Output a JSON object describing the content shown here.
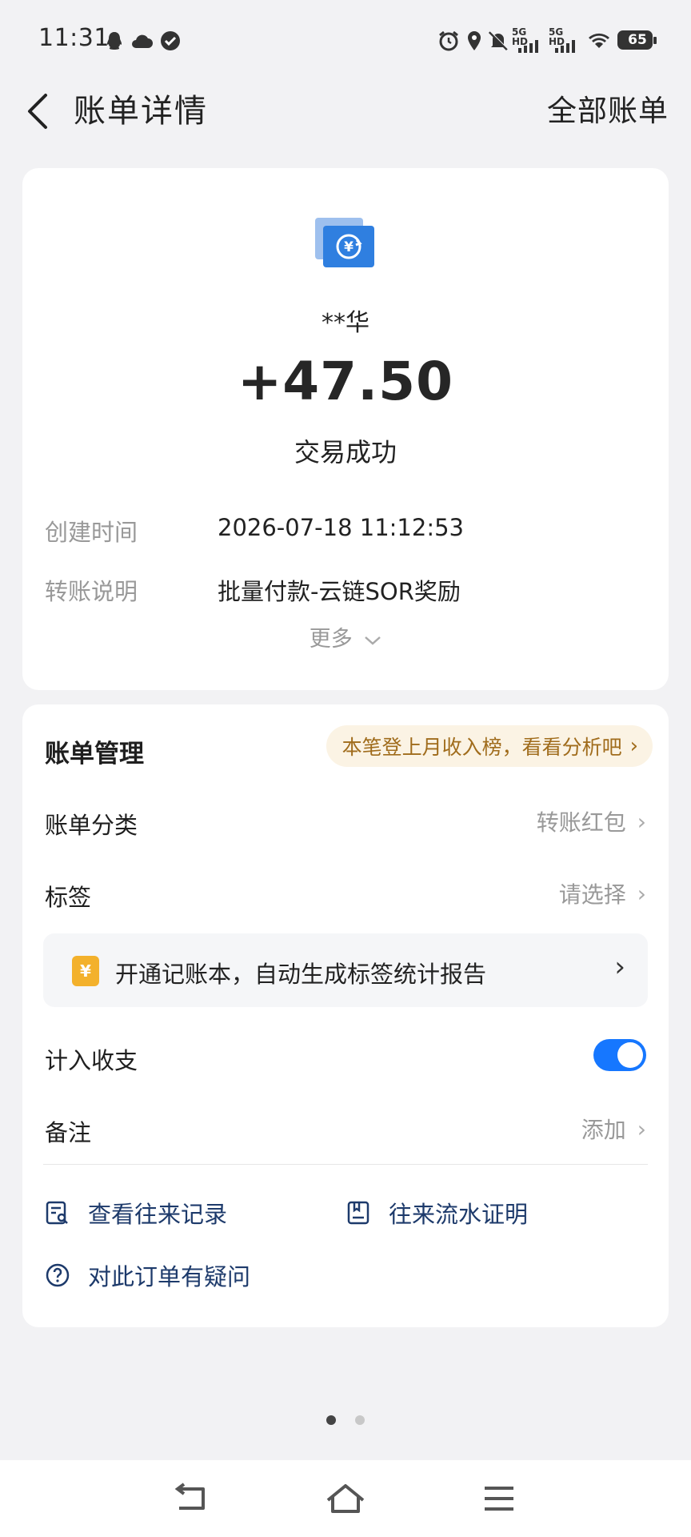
{
  "status_bar": {
    "time": "11:31",
    "battery": "65",
    "signal_label": "5G HD",
    "icons": [
      "qq-icon",
      "cloud-icon",
      "check-circle-icon",
      "alarm-icon",
      "location-icon",
      "mute-bell-icon",
      "signal-5g-hd-icon",
      "signal-5g-hd-icon",
      "wifi-icon",
      "battery-icon"
    ]
  },
  "header": {
    "title": "账单详情",
    "right_link": "全部账单"
  },
  "summary": {
    "icon": "transfer-yuan-icon",
    "payer": "**华",
    "amount": "+47.50",
    "status": "交易成功",
    "rows": [
      {
        "label": "创建时间",
        "value": "2026-07-18 11:12:53"
      },
      {
        "label": "转账说明",
        "value": "批量付款-云链SOR奖励"
      }
    ],
    "more": "更多"
  },
  "manage": {
    "title": "账单管理",
    "promo": "本笔登上月收入榜，看看分析吧",
    "category_label": "账单分类",
    "category_value": "转账红包",
    "tag_label": "标签",
    "tag_value": "请选择",
    "ledger_icon_char": "¥",
    "ledger_text": "开通记账本，自动生成标签统计报告",
    "include_label": "计入收支",
    "include_on": true,
    "note_label": "备注",
    "note_value": "添加",
    "links": {
      "history": "查看往来记录",
      "flow_proof": "往来流水证明",
      "question": "对此订单有疑问"
    }
  },
  "pager": {
    "current": 1,
    "total": 2
  },
  "colors": {
    "accent": "#1677ff",
    "link": "#1d3a6b",
    "promo_text": "#a06c1c",
    "promo_bg": "#fbf3e4"
  }
}
